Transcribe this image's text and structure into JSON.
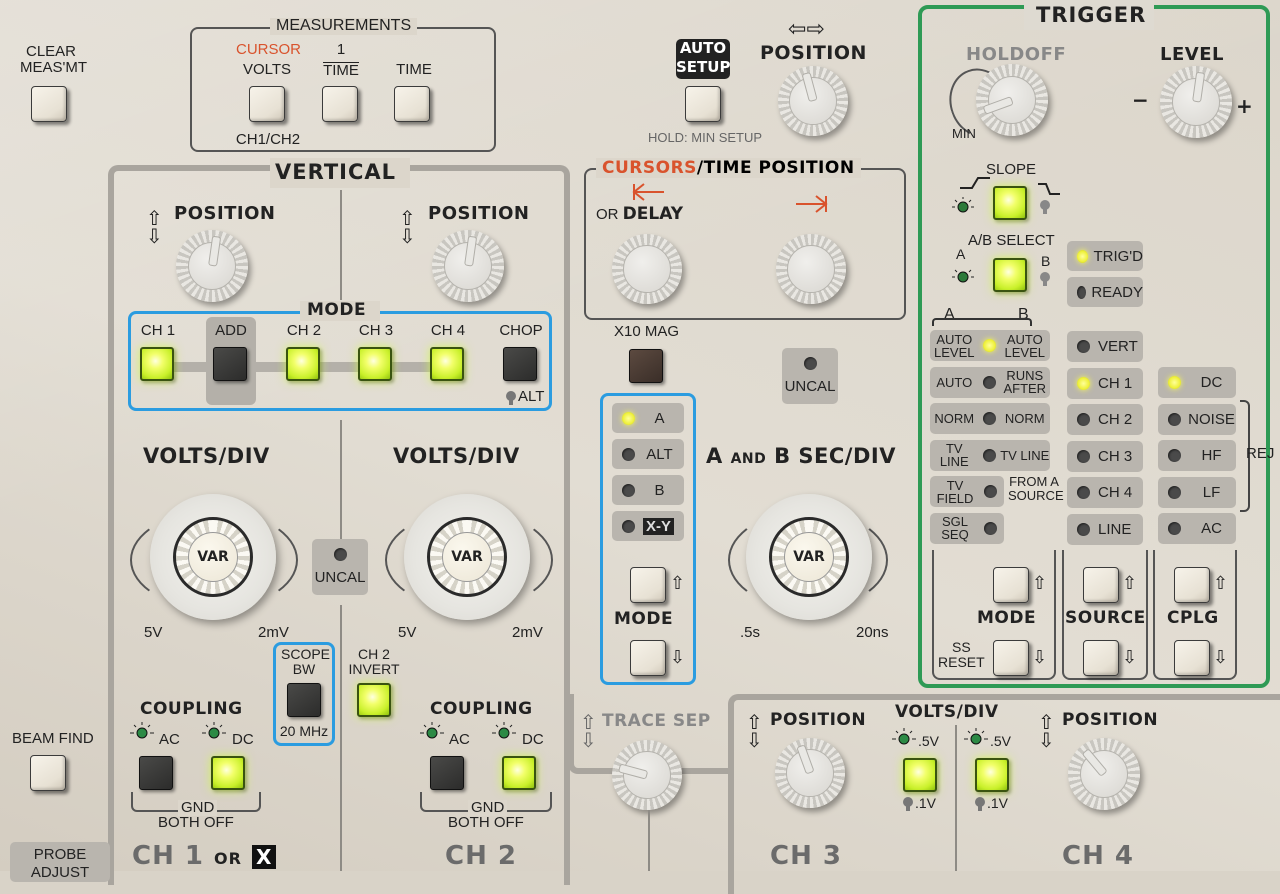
{
  "measurements": {
    "title": "MEASUREMENTS",
    "clear_label_1": "CLEAR",
    "clear_label_2": "MEAS'MT",
    "cursor_label": "CURSOR",
    "volts_label": "VOLTS",
    "inv_time_num": "1",
    "inv_time_den": "TIME",
    "time_label": "TIME",
    "ch_label": "CH1/CH2"
  },
  "auto_setup": {
    "label_1": "AUTO",
    "label_2": "SETUP",
    "hold_label": "HOLD: MIN SETUP"
  },
  "horizontal_position": {
    "arrows": "⇦⇨",
    "label": "POSITION"
  },
  "trigger": {
    "title": "TRIGGER",
    "holdoff_label": "HOLDOFF",
    "holdoff_min": "MIN",
    "level_label": "LEVEL",
    "level_minus": "−",
    "level_plus": "+",
    "slope_label": "SLOPE",
    "ab_select_label": "A/B SELECT",
    "ab_a": "A",
    "ab_b": "B",
    "status": [
      {
        "label": "TRIG'D",
        "on": true
      },
      {
        "label": "READY",
        "on": false
      }
    ],
    "group_a": "A",
    "group_b": "B",
    "mode_rows": [
      {
        "left": "AUTO LEVEL",
        "right": "AUTO LEVEL",
        "on": true
      },
      {
        "left": "AUTO",
        "right": "RUNS AFTER",
        "on": false
      },
      {
        "left": "NORM",
        "right": "NORM",
        "on": false
      },
      {
        "left": "TV LINE",
        "right": "TV LINE",
        "on": false
      },
      {
        "left": "TV FIELD",
        "right": "",
        "on": false
      },
      {
        "left": "SGL SEQ",
        "right": "",
        "on": false
      }
    ],
    "from_a_source": "FROM A SOURCE",
    "source_items": [
      {
        "label": "VERT",
        "on": false
      },
      {
        "label": "CH 1",
        "on": true
      },
      {
        "label": "CH 2",
        "on": false
      },
      {
        "label": "CH 3",
        "on": false
      },
      {
        "label": "CH 4",
        "on": false
      },
      {
        "label": "LINE",
        "on": false
      }
    ],
    "coupling_items": [
      {
        "label": "DC",
        "on": true
      },
      {
        "label": "NOISE",
        "on": false
      },
      {
        "label": "HF",
        "on": false
      },
      {
        "label": "LF",
        "on": false
      },
      {
        "label": "AC",
        "on": false
      }
    ],
    "rej_label": "REJ",
    "mode_label": "MODE",
    "ss_reset_1": "SS",
    "ss_reset_2": "RESET",
    "source_label": "SOURCE",
    "cplg_label": "CPLG"
  },
  "cursors": {
    "title_red": "CURSORS",
    "title_rest": "/TIME POSITION",
    "or_label": "OR",
    "delay_label": "DELAY",
    "x10_mag": "X10 MAG",
    "uncal": "UNCAL"
  },
  "horiz_mode": {
    "items": [
      {
        "label": "A",
        "on": true
      },
      {
        "label": "ALT",
        "on": false
      },
      {
        "label": "B",
        "on": false
      },
      {
        "label": "X-Y",
        "on": false
      }
    ],
    "label": "MODE"
  },
  "sec_div": {
    "label_a": "A",
    "label_and": "AND",
    "label_b": "B",
    "label_rest": "SEC/DIV",
    "min": ".5s",
    "max": "20ns",
    "var": "VAR"
  },
  "vertical": {
    "title": "VERTICAL",
    "position_label": "POSITION",
    "mode_title": "MODE",
    "mode_buttons": [
      {
        "label": "CH 1",
        "on": true
      },
      {
        "label": "ADD",
        "on": false
      },
      {
        "label": "CH 2",
        "on": true
      },
      {
        "label": "CH 3",
        "on": true
      },
      {
        "label": "CH 4",
        "on": true
      },
      {
        "label": "CHOP",
        "on": false
      }
    ],
    "alt_label": "ALT",
    "volts_div": "VOLTS/DIV",
    "var": "VAR",
    "min": "5V",
    "max": "2mV",
    "uncal": "UNCAL",
    "scope_bw_1": "SCOPE",
    "scope_bw_2": "BW",
    "scope_bw_freq": "20 MHz",
    "ch2_invert_1": "CH 2",
    "ch2_invert_2": "INVERT",
    "coupling_label": "COUPLING",
    "ac": "AC",
    "dc": "DC",
    "gnd": "GND",
    "both_off": "BOTH OFF",
    "ch1_label": "CH 1",
    "ch1_or": "OR",
    "ch1_x": "X",
    "ch2_label": "CH 2"
  },
  "beam_find": "BEAM FIND",
  "probe_adjust": "PROBE ADJUST",
  "trace_sep": "TRACE SEP",
  "ch34": {
    "position_label": "POSITION",
    "volts_div": "VOLTS/DIV",
    "v_high": ".5V",
    "v_low": ".1V",
    "ch3_label": "CH 3",
    "ch4_label": "CH 4"
  }
}
